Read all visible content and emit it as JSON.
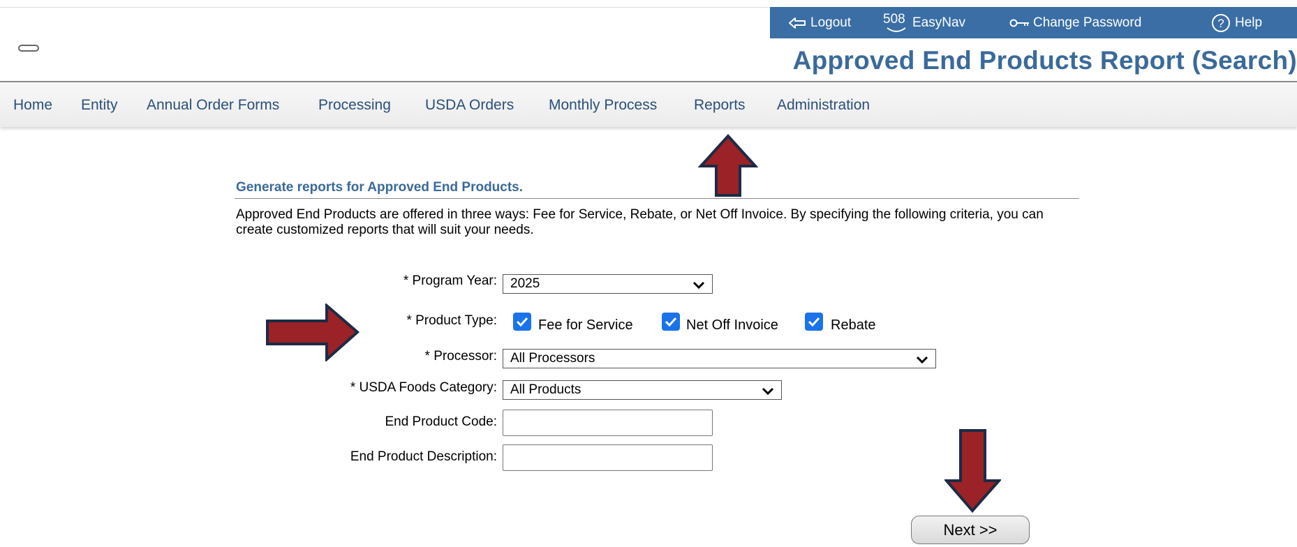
{
  "toolbar": {
    "logout_label": "Logout",
    "easynav_badge": "508",
    "easynav_label": "EasyNav",
    "change_password_label": "Change Password",
    "help_label": "Help"
  },
  "page": {
    "title": "Approved End Products Report (Search)"
  },
  "menu": {
    "items": [
      {
        "label": "Home"
      },
      {
        "label": "Entity"
      },
      {
        "label": "Annual Order Forms"
      },
      {
        "label": "Processing"
      },
      {
        "label": "USDA Orders"
      },
      {
        "label": "Monthly Process"
      },
      {
        "label": "Reports"
      },
      {
        "label": "Administration"
      }
    ]
  },
  "section": {
    "heading": "Generate reports for Approved End Products.",
    "description": "Approved End Products are offered in three ways: Fee for Service, Rebate, or Net Off Invoice.  By specifying the following criteria, you can create customized reports that will suit your needs."
  },
  "form": {
    "program_year": {
      "label": "* Program Year:",
      "value": "2025"
    },
    "product_type": {
      "label": "* Product Type:",
      "options": [
        {
          "label": "Fee for Service",
          "checked": true
        },
        {
          "label": "Net Off Invoice",
          "checked": true
        },
        {
          "label": "Rebate",
          "checked": true
        }
      ]
    },
    "processor": {
      "label": "* Processor:",
      "value": "All Processors"
    },
    "foods_category": {
      "label": "* USDA Foods Category:",
      "value": "All Products"
    },
    "end_product_code": {
      "label": "End Product Code:",
      "value": ""
    },
    "end_product_description": {
      "label": "End Product Description:",
      "value": ""
    }
  },
  "actions": {
    "next_label": "Next >>"
  },
  "colors": {
    "toolbar_bg": "#3a6ea5",
    "title": "#3a6a99",
    "menu_link": "#2b4f7a",
    "checkbox": "#1a73e8",
    "annotation_arrow": "#9b2226",
    "annotation_outline": "#1d2b45"
  },
  "icons": {
    "logout": "logout-arrow-icon",
    "easynav": "easynav-smile-icon",
    "change_password": "key-icon",
    "help": "help-circle-icon",
    "dropdown": "chevron-down-icon",
    "checkbox": "checkmark-icon"
  }
}
